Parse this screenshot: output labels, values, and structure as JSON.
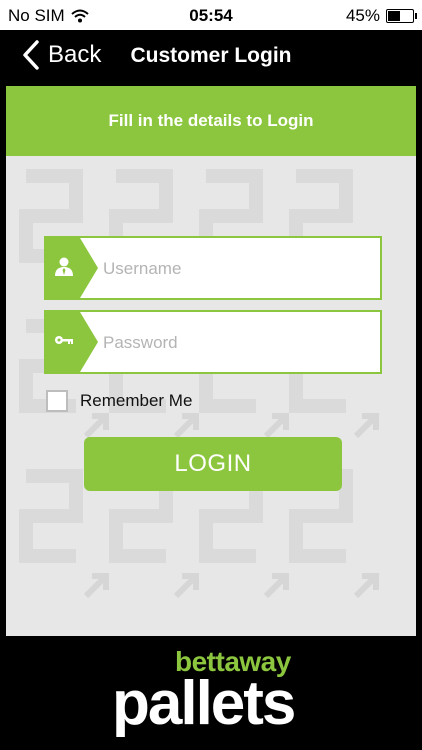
{
  "status_bar": {
    "carrier": "No SIM",
    "time": "05:54",
    "battery_percent": "45%",
    "battery_fraction": 0.45
  },
  "nav": {
    "back_label": "Back",
    "title": "Customer Login"
  },
  "form": {
    "header": "Fill in the details to Login",
    "username": {
      "placeholder": "Username",
      "value": ""
    },
    "password": {
      "placeholder": "Password",
      "value": ""
    },
    "remember_label": "Remember Me",
    "remember_checked": false,
    "login_label": "LOGIN"
  },
  "footer": {
    "logo_line1": "bettaway",
    "logo_line2": "pallets"
  },
  "colors": {
    "accent": "#8cc63f",
    "background": "#000000",
    "panel": "#e7e7e7"
  },
  "icons": [
    "wifi-icon",
    "back-chevron-icon",
    "user-icon",
    "key-icon",
    "battery-icon"
  ]
}
